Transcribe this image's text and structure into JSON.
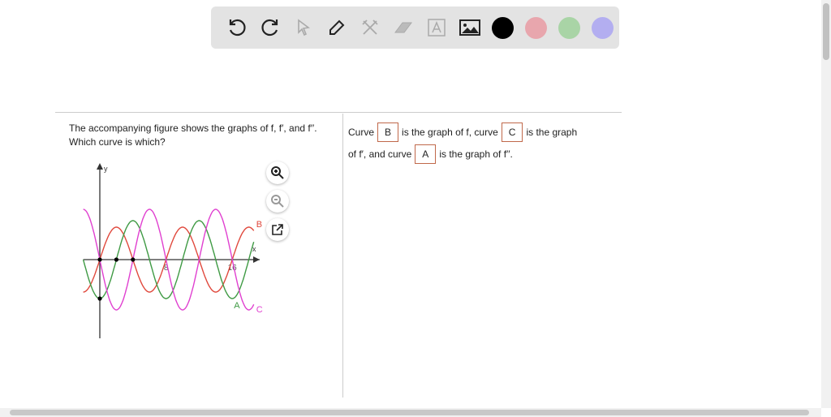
{
  "toolbar": {
    "tools": [
      "undo",
      "redo",
      "select",
      "pen",
      "tools",
      "eraser",
      "text",
      "image"
    ],
    "colors": [
      "#000000",
      "#e8a6ad",
      "#a9d4a6",
      "#b3aef0"
    ]
  },
  "question": {
    "text": "The accompanying figure shows the graphs of f, f′, and f′′. Which curve is which?"
  },
  "answer": {
    "p1": "Curve",
    "b1": "B",
    "p2": "is the graph of f, curve",
    "b2": "C",
    "p3": "is the graph",
    "p4": "of f′, and curve",
    "b3": "A",
    "p5": "is the graph of f′′."
  },
  "chart_data": {
    "type": "line",
    "xlabel": "x",
    "ylabel": "y",
    "xticks": [
      "8",
      "16"
    ],
    "xlim": [
      -2,
      18.6
    ],
    "series": [
      {
        "name": "B",
        "color": "#e0483c",
        "function": "sin",
        "amplitude": 1.0,
        "period": 8,
        "phase_sign": 1
      },
      {
        "name": "A",
        "color": "#3f9a44",
        "function": "cos",
        "amplitude": 1.2,
        "period": 8,
        "phase_sign": -1
      },
      {
        "name": "C",
        "color": "#e040d0",
        "function": "sin",
        "amplitude": 1.55,
        "period": 8,
        "phase_sign": -1
      }
    ],
    "marked_points": [
      [
        0,
        0
      ],
      [
        2,
        0
      ],
      [
        4,
        0
      ],
      [
        0,
        -1.2
      ]
    ]
  }
}
